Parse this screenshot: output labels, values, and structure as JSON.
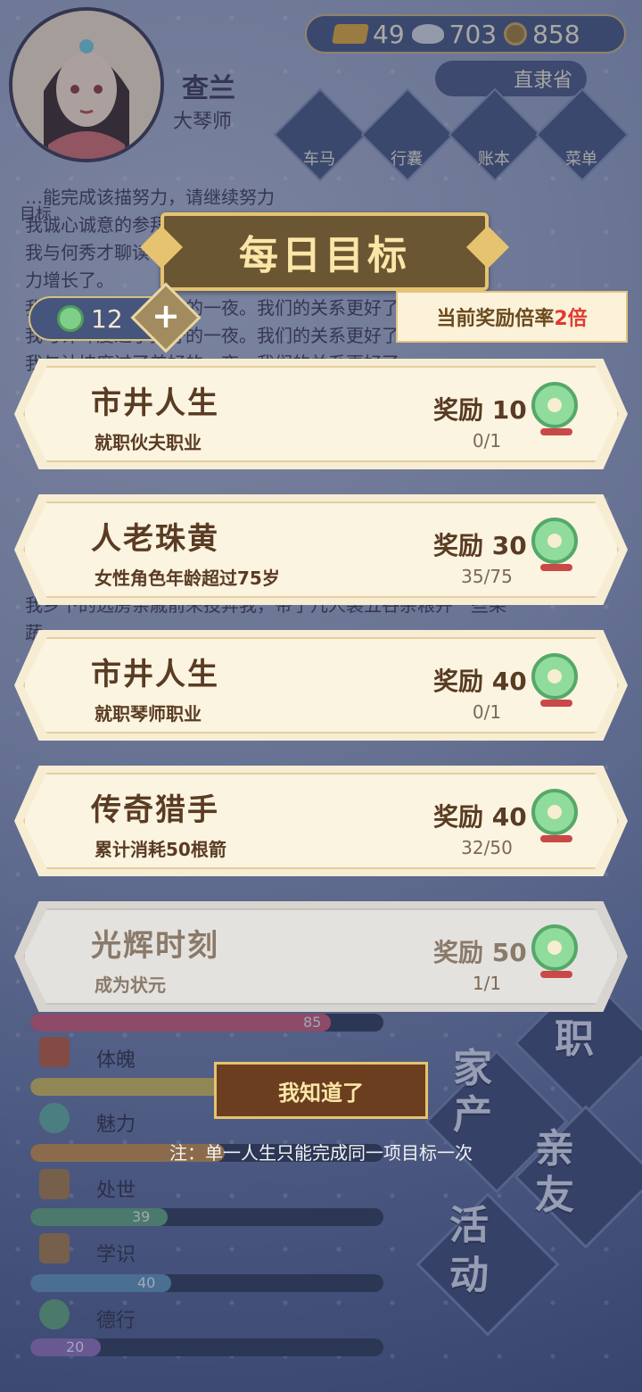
{
  "player": {
    "name": "查兰",
    "title": "大琴师"
  },
  "currency": {
    "gold": "49",
    "silver": "703",
    "coins": "858"
  },
  "location": "直隶省",
  "menu": [
    {
      "label": "车马",
      "icon": "carriage-icon"
    },
    {
      "label": "行囊",
      "icon": "bag-icon"
    },
    {
      "label": "账本",
      "icon": "ledger-icon"
    },
    {
      "label": "菜单",
      "icon": "more-icon"
    }
  ],
  "goal_tab_label": "目标",
  "log_lines": [
    "…能完成该描努力，请继续努力",
    "我诚心诚意的参拜了如来佛祖，希望心愿能够实现。",
    "我与何秀才聊读书……我与人交谈的能",
    "力增长了。",
    "我与计坤度过了美好的一夜。我们的关系更好了",
    "我与计坤度过了美好的一夜。我们的关系更好了",
    "我与计坤度过了美好的一夜。我们的关系更好了",
    "我乡下的远房亲戚前来投奔我，带了几人装五谷杂粮并一些果",
    "蔬……"
  ],
  "dialog": {
    "title": "每日目标",
    "tokens": "12",
    "multiplier_prefix": "当前奖励倍率",
    "multiplier_value": "2倍",
    "reward_label": "奖励",
    "goals": [
      {
        "title": "市井人生",
        "desc": "就职伙夫职业",
        "reward": "10",
        "progress": "0/1",
        "done": false
      },
      {
        "title": "人老珠黄",
        "desc": "女性角色年龄超过75岁",
        "reward": "30",
        "progress": "35/75",
        "done": false
      },
      {
        "title": "市井人生",
        "desc": "就职琴师职业",
        "reward": "40",
        "progress": "0/1",
        "done": false
      },
      {
        "title": "传奇猎手",
        "desc": "累计消耗50根箭",
        "reward": "40",
        "progress": "32/50",
        "done": false
      },
      {
        "title": "光辉时刻",
        "desc": "成为状元",
        "reward": "50",
        "progress": "1/1",
        "done": true
      }
    ],
    "ack_button": "我知道了",
    "note": "注：单一人生只能完成同一项目标一次"
  },
  "stats": [
    {
      "label": "",
      "value": "85",
      "fraction": 0.85,
      "color": "#c45a74"
    },
    {
      "label": "体魄",
      "value": "",
      "fraction": 0.6,
      "color": "#c9b65a"
    },
    {
      "label": "魅力",
      "value": "",
      "fraction": 0.55,
      "color": "#c18a4a"
    },
    {
      "label": "处世",
      "value": "39",
      "fraction": 0.39,
      "color": "#5fa07a"
    },
    {
      "label": "学识",
      "value": "40",
      "fraction": 0.4,
      "color": "#5f8fb7"
    },
    {
      "label": "德行",
      "value": "20",
      "fraction": 0.2,
      "color": "#8a6fb7"
    }
  ],
  "side_menu": [
    "职",
    "家产",
    "亲友",
    "活动"
  ]
}
